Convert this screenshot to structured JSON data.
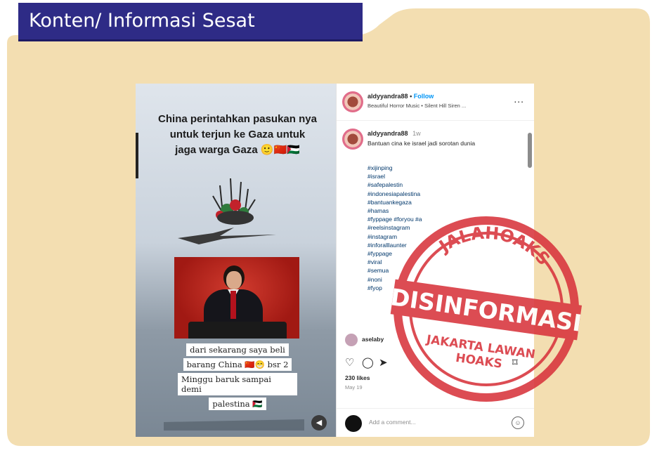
{
  "title": "Konten/ Informasi Sesat",
  "colors": {
    "background": "#f3deb1",
    "title_tab": "#2e2b86",
    "stamp": "#d8343c"
  },
  "video": {
    "caption_lines": [
      "China perintahkan pasukan nya",
      "untuk terjun ke Gaza untuk",
      "jaga warga Gaza 🙂🇨🇳🇵🇸"
    ],
    "subtitle_lines": [
      "dari sekarang saya beli",
      "barang China 🇨🇳😁 bsr 2",
      "Minggu baruk sampai demi",
      "palestina 🇵🇸"
    ],
    "mute_icon": "speaker-muted-icon"
  },
  "instagram": {
    "username": "aldyyandra88",
    "follow_label": "Follow",
    "audio": "Beautiful Horror Music • Silent Hill Siren ...",
    "more": "...",
    "caption_user": "aldyyandra88",
    "caption_time": "1w",
    "caption_text": "Bantuan cina ke israel jadi sorotan dunia",
    "hashtags": [
      "#xijinping",
      "#israel",
      "#safepalestin",
      "#indonesiapalestina",
      "#bantuankegaza",
      "#hamas",
      "#fyppage #foryou #a",
      "#reelsinstagram",
      "#instagram",
      "#inforalllaunter",
      "#fyppage",
      "#viral",
      "#semua",
      "#noni",
      "#fyop"
    ],
    "comment_user": "aselaby",
    "likes": "230 likes",
    "date": "May 19",
    "add_comment_placeholder": "Add a comment...",
    "emoji_icon": "☺"
  },
  "stamp": {
    "top_text": "JALAHOAKS",
    "main_text": "DISINFORMASI",
    "bottom_text_1": "JAKARTA LAWAN",
    "bottom_text_2": "HOAKS"
  }
}
